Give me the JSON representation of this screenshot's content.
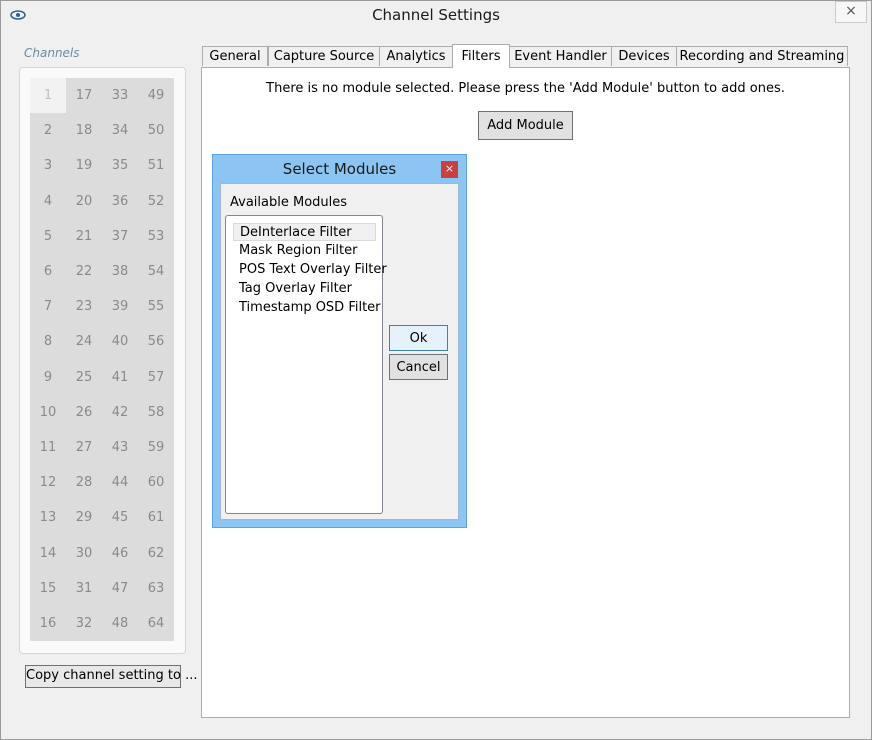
{
  "window": {
    "title": "Channel Settings",
    "close_label": "×"
  },
  "channels": {
    "label": "Channels",
    "selected": "1",
    "rows": [
      [
        "1",
        "17",
        "33",
        "49"
      ],
      [
        "2",
        "18",
        "34",
        "50"
      ],
      [
        "3",
        "19",
        "35",
        "51"
      ],
      [
        "4",
        "20",
        "36",
        "52"
      ],
      [
        "5",
        "21",
        "37",
        "53"
      ],
      [
        "6",
        "22",
        "38",
        "54"
      ],
      [
        "7",
        "23",
        "39",
        "55"
      ],
      [
        "8",
        "24",
        "40",
        "56"
      ],
      [
        "9",
        "25",
        "41",
        "57"
      ],
      [
        "10",
        "26",
        "42",
        "58"
      ],
      [
        "11",
        "27",
        "43",
        "59"
      ],
      [
        "12",
        "28",
        "44",
        "60"
      ],
      [
        "13",
        "29",
        "45",
        "61"
      ],
      [
        "14",
        "30",
        "46",
        "62"
      ],
      [
        "15",
        "31",
        "47",
        "63"
      ],
      [
        "16",
        "32",
        "48",
        "64"
      ]
    ],
    "copy_button": "Copy channel setting to ..."
  },
  "tabs": [
    {
      "label": "General"
    },
    {
      "label": "Capture Source"
    },
    {
      "label": "Analytics"
    },
    {
      "label": "Filters"
    },
    {
      "label": "Event Handler"
    },
    {
      "label": "Devices"
    },
    {
      "label": "Recording and Streaming"
    }
  ],
  "active_tab": "Filters",
  "filters": {
    "message": "There is no module selected. Please press the 'Add Module' button to add ones.",
    "add_module_button": "Add Module"
  },
  "dialog": {
    "title": "Select Modules",
    "close_label": "×",
    "available_label": "Available Modules",
    "modules": [
      "DeInterlace Filter",
      "Mask Region Filter",
      "POS Text Overlay Filter",
      "Tag Overlay Filter",
      "Timestamp OSD Filter"
    ],
    "selected_module": "DeInterlace Filter",
    "ok_button": "Ok",
    "cancel_button": "Cancel"
  },
  "colors": {
    "dialog_frame": "#8cc4f2",
    "dialog_close": "#c94040",
    "channel_cell": "#dcdcdc"
  }
}
